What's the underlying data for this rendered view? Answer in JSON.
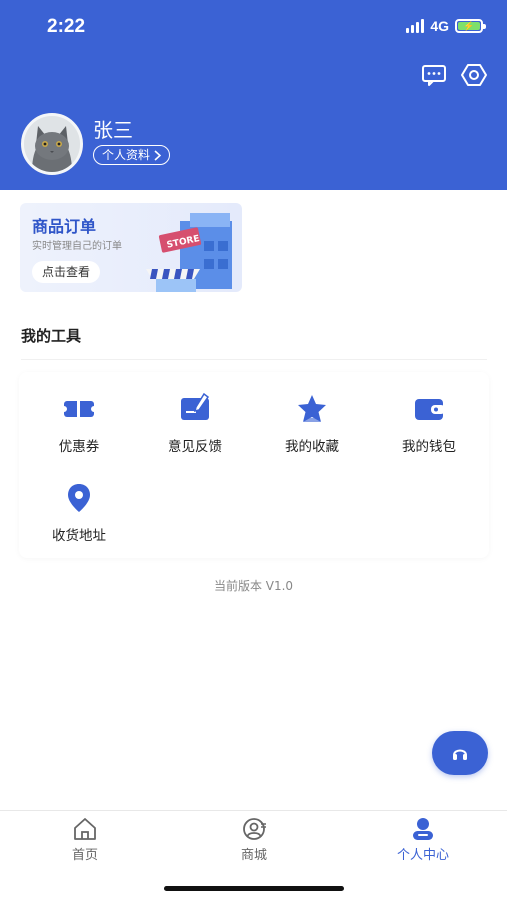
{
  "status_bar": {
    "time": "2:22",
    "network": "4G"
  },
  "header": {
    "user_name": "张三",
    "profile_link": "个人资料",
    "icons": [
      "message-icon",
      "settings-icon"
    ]
  },
  "order_card": {
    "title": "商品订单",
    "subtitle": "实时管理自己的订单",
    "button": "点击查看",
    "illustration_text": "STORE"
  },
  "tools": {
    "title": "我的工具",
    "items": [
      {
        "label": "优惠券",
        "icon": "coupon-icon"
      },
      {
        "label": "意见反馈",
        "icon": "feedback-icon"
      },
      {
        "label": "我的收藏",
        "icon": "favorite-star-icon"
      },
      {
        "label": "我的钱包",
        "icon": "wallet-icon"
      },
      {
        "label": "收货地址",
        "icon": "location-pin-icon"
      }
    ]
  },
  "version": "当前版本 V1.0",
  "tabbar": {
    "tabs": [
      {
        "label": "首页",
        "icon": "home-icon",
        "active": false
      },
      {
        "label": "商城",
        "icon": "mall-user-icon",
        "active": false
      },
      {
        "label": "个人中心",
        "icon": "profile-icon",
        "active": true
      }
    ]
  },
  "colors": {
    "primary": "#3b62d4",
    "battery": "#7ee06b"
  }
}
